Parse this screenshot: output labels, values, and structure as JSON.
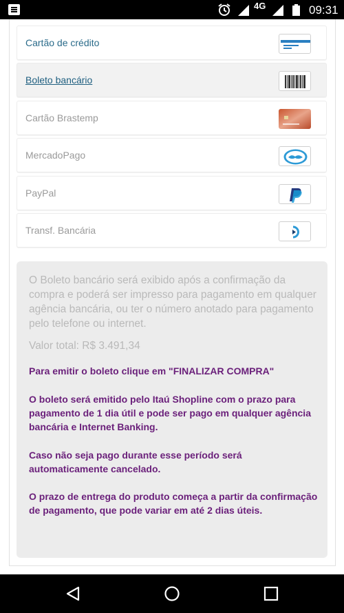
{
  "status_bar": {
    "network": "4G",
    "time": "09:31"
  },
  "payment_options": [
    {
      "label": "Cartão de crédito",
      "icon": "credit-card-icon"
    },
    {
      "label": "Boleto bancário",
      "icon": "barcode-icon"
    },
    {
      "label": "Cartão Brastemp",
      "icon": "brastemp-card-icon"
    },
    {
      "label": "MercadoPago",
      "icon": "mercadopago-icon"
    },
    {
      "label": "PayPal",
      "icon": "paypal-icon"
    },
    {
      "label": "Transf. Bancária",
      "icon": "bank-transfer-icon"
    }
  ],
  "boleto_info": {
    "description": "O Boleto bancário será exibido após a confirmação da compra e poderá ser impresso para pagamento em qualquer agência bancária, ou ter o número anotado para pagamento pelo telefone ou internet.",
    "total": "Valor total: R$ 3.491,34",
    "instruction": "Para emitir o boleto clique em \"FINALIZAR COMPRA\"",
    "issuer_note": "O boleto será emitido pelo Itaú Shopline com o prazo para pagamento de 1 dia útil e pode ser pago em qualquer agência bancária e Internet Banking.",
    "cancel_note": "Caso não seja pago durante esse período será automaticamente cancelado.",
    "delivery_note": "O prazo de entrega do produto começa a partir da confirmação de pagamento, que pode variar em até 2 dias úteis."
  },
  "colors": {
    "link": "#1f5f80",
    "muted_text": "#9a9a9a",
    "highlight_text": "#6a1f7a",
    "info_background": "#ececec"
  }
}
